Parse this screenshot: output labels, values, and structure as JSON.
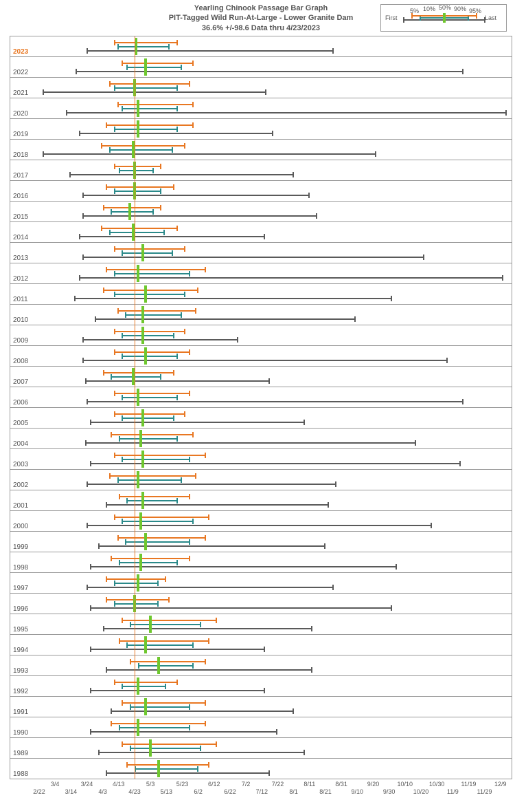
{
  "title_line1": "Yearling Chinook Passage Bar Graph",
  "title_line2": "PIT-Tagged Wild Run-At-Large - Lower Granite Dam",
  "title_line3": "36.6% +/-98.6 Data thru 4/23/2023",
  "legend": {
    "first": "First",
    "p5": "5%",
    "p10": "10%",
    "p50": "50%",
    "p90": "90%",
    "p95": "95%",
    "last": "Last"
  },
  "colors": {
    "grey": "#5a5a5a",
    "teal": "#2a8a8a",
    "orange": "#e87722",
    "green": "#6ec72e"
  },
  "today_doy": 113,
  "xaxis": {
    "min_doy": 53,
    "max_doy": 350,
    "ticks": [
      {
        "label": "2/22",
        "doy": 53,
        "row": 1
      },
      {
        "label": "3/4",
        "doy": 63,
        "row": 0
      },
      {
        "label": "3/14",
        "doy": 73,
        "row": 1
      },
      {
        "label": "3/24",
        "doy": 83,
        "row": 0
      },
      {
        "label": "4/3",
        "doy": 93,
        "row": 1
      },
      {
        "label": "4/13",
        "doy": 103,
        "row": 0
      },
      {
        "label": "4/23",
        "doy": 113,
        "row": 1
      },
      {
        "label": "5/3",
        "doy": 123,
        "row": 0
      },
      {
        "label": "5/13",
        "doy": 133,
        "row": 1
      },
      {
        "label": "5/23",
        "doy": 143,
        "row": 0
      },
      {
        "label": "6/2",
        "doy": 153,
        "row": 1
      },
      {
        "label": "6/12",
        "doy": 163,
        "row": 0
      },
      {
        "label": "6/22",
        "doy": 173,
        "row": 1
      },
      {
        "label": "7/2",
        "doy": 183,
        "row": 0
      },
      {
        "label": "7/12",
        "doy": 193,
        "row": 1
      },
      {
        "label": "7/22",
        "doy": 203,
        "row": 0
      },
      {
        "label": "8/1",
        "doy": 213,
        "row": 1
      },
      {
        "label": "8/11",
        "doy": 223,
        "row": 0
      },
      {
        "label": "8/21",
        "doy": 233,
        "row": 1
      },
      {
        "label": "8/31",
        "doy": 243,
        "row": 0
      },
      {
        "label": "9/10",
        "doy": 253,
        "row": 1
      },
      {
        "label": "9/20",
        "doy": 263,
        "row": 0
      },
      {
        "label": "9/30",
        "doy": 273,
        "row": 1
      },
      {
        "label": "10/10",
        "doy": 283,
        "row": 0
      },
      {
        "label": "10/20",
        "doy": 293,
        "row": 1
      },
      {
        "label": "10/30",
        "doy": 303,
        "row": 0
      },
      {
        "label": "11/9",
        "doy": 313,
        "row": 1
      },
      {
        "label": "11/19",
        "doy": 323,
        "row": 0
      },
      {
        "label": "11/29",
        "doy": 333,
        "row": 1
      },
      {
        "label": "12/9",
        "doy": 343,
        "row": 0
      }
    ]
  },
  "chart_data": {
    "type": "bar",
    "note": "Values are approximate day-of-year read from chart gridlines",
    "series_meta": [
      "first",
      "p5",
      "p10",
      "p50",
      "p90",
      "p95",
      "last"
    ],
    "rows": [
      {
        "year": "2023",
        "current": true,
        "first": 83,
        "p5": 100,
        "p10": 102,
        "p50": 114,
        "p90": 135,
        "p95": 140,
        "last": 238
      },
      {
        "year": "2022",
        "first": 76,
        "p5": 105,
        "p10": 108,
        "p50": 120,
        "p90": 143,
        "p95": 150,
        "last": 320
      },
      {
        "year": "2021",
        "first": 55,
        "p5": 97,
        "p10": 100,
        "p50": 113,
        "p90": 140,
        "p95": 148,
        "last": 196
      },
      {
        "year": "2020",
        "first": 70,
        "p5": 102,
        "p10": 105,
        "p50": 115,
        "p90": 140,
        "p95": 150,
        "last": 347
      },
      {
        "year": "2019",
        "first": 78,
        "p5": 95,
        "p10": 100,
        "p50": 115,
        "p90": 140,
        "p95": 150,
        "last": 200
      },
      {
        "year": "2018",
        "first": 55,
        "p5": 92,
        "p10": 97,
        "p50": 112,
        "p90": 137,
        "p95": 145,
        "last": 265
      },
      {
        "year": "2017",
        "first": 72,
        "p5": 100,
        "p10": 103,
        "p50": 113,
        "p90": 125,
        "p95": 130,
        "last": 213
      },
      {
        "year": "2016",
        "first": 80,
        "p5": 95,
        "p10": 100,
        "p50": 113,
        "p90": 130,
        "p95": 138,
        "last": 223
      },
      {
        "year": "2015",
        "first": 80,
        "p5": 93,
        "p10": 98,
        "p50": 110,
        "p90": 125,
        "p95": 130,
        "last": 228
      },
      {
        "year": "2014",
        "first": 78,
        "p5": 92,
        "p10": 97,
        "p50": 112,
        "p90": 132,
        "p95": 140,
        "last": 195
      },
      {
        "year": "2013",
        "first": 80,
        "p5": 100,
        "p10": 105,
        "p50": 118,
        "p90": 137,
        "p95": 145,
        "last": 295
      },
      {
        "year": "2012",
        "first": 78,
        "p5": 95,
        "p10": 100,
        "p50": 115,
        "p90": 148,
        "p95": 158,
        "last": 345
      },
      {
        "year": "2011",
        "first": 75,
        "p5": 93,
        "p10": 100,
        "p50": 120,
        "p90": 145,
        "p95": 153,
        "last": 275
      },
      {
        "year": "2010",
        "first": 88,
        "p5": 102,
        "p10": 107,
        "p50": 118,
        "p90": 143,
        "p95": 152,
        "last": 252
      },
      {
        "year": "2009",
        "first": 80,
        "p5": 100,
        "p10": 105,
        "p50": 118,
        "p90": 138,
        "p95": 145,
        "last": 178
      },
      {
        "year": "2008",
        "first": 80,
        "p5": 100,
        "p10": 105,
        "p50": 120,
        "p90": 140,
        "p95": 148,
        "last": 310
      },
      {
        "year": "2007",
        "first": 82,
        "p5": 93,
        "p10": 98,
        "p50": 112,
        "p90": 130,
        "p95": 138,
        "last": 198
      },
      {
        "year": "2006",
        "first": 83,
        "p5": 100,
        "p10": 105,
        "p50": 115,
        "p90": 140,
        "p95": 148,
        "last": 320
      },
      {
        "year": "2005",
        "first": 85,
        "p5": 100,
        "p10": 105,
        "p50": 118,
        "p90": 138,
        "p95": 145,
        "last": 220
      },
      {
        "year": "2004",
        "first": 82,
        "p5": 98,
        "p10": 103,
        "p50": 117,
        "p90": 140,
        "p95": 150,
        "last": 290
      },
      {
        "year": "2003",
        "first": 85,
        "p5": 100,
        "p10": 105,
        "p50": 118,
        "p90": 148,
        "p95": 158,
        "last": 318
      },
      {
        "year": "2002",
        "first": 83,
        "p5": 97,
        "p10": 102,
        "p50": 115,
        "p90": 143,
        "p95": 152,
        "last": 240
      },
      {
        "year": "2001",
        "first": 95,
        "p5": 103,
        "p10": 108,
        "p50": 118,
        "p90": 140,
        "p95": 148,
        "last": 235
      },
      {
        "year": "2000",
        "first": 83,
        "p5": 100,
        "p10": 105,
        "p50": 117,
        "p90": 150,
        "p95": 160,
        "last": 300
      },
      {
        "year": "1999",
        "first": 90,
        "p5": 102,
        "p10": 107,
        "p50": 120,
        "p90": 148,
        "p95": 158,
        "last": 233
      },
      {
        "year": "1998",
        "first": 85,
        "p5": 98,
        "p10": 103,
        "p50": 117,
        "p90": 140,
        "p95": 148,
        "last": 278
      },
      {
        "year": "1997",
        "first": 83,
        "p5": 95,
        "p10": 100,
        "p50": 115,
        "p90": 128,
        "p95": 133,
        "last": 238
      },
      {
        "year": "1996",
        "first": 85,
        "p5": 95,
        "p10": 100,
        "p50": 113,
        "p90": 128,
        "p95": 135,
        "last": 275
      },
      {
        "year": "1995",
        "first": 93,
        "p5": 105,
        "p10": 110,
        "p50": 123,
        "p90": 155,
        "p95": 165,
        "last": 225
      },
      {
        "year": "1994",
        "first": 85,
        "p5": 103,
        "p10": 108,
        "p50": 120,
        "p90": 150,
        "p95": 160,
        "last": 195
      },
      {
        "year": "1993",
        "first": 95,
        "p5": 110,
        "p10": 115,
        "p50": 128,
        "p90": 150,
        "p95": 158,
        "last": 225
      },
      {
        "year": "1992",
        "first": 85,
        "p5": 100,
        "p10": 105,
        "p50": 115,
        "p90": 133,
        "p95": 140,
        "last": 195
      },
      {
        "year": "1991",
        "first": 98,
        "p5": 105,
        "p10": 110,
        "p50": 120,
        "p90": 148,
        "p95": 158,
        "last": 213
      },
      {
        "year": "1990",
        "first": 85,
        "p5": 98,
        "p10": 103,
        "p50": 115,
        "p90": 148,
        "p95": 158,
        "last": 203
      },
      {
        "year": "1989",
        "first": 90,
        "p5": 105,
        "p10": 110,
        "p50": 123,
        "p90": 155,
        "p95": 165,
        "last": 220
      },
      {
        "year": "1988",
        "first": 95,
        "p5": 108,
        "p10": 113,
        "p50": 128,
        "p90": 153,
        "p95": 160,
        "last": 198
      }
    ]
  }
}
